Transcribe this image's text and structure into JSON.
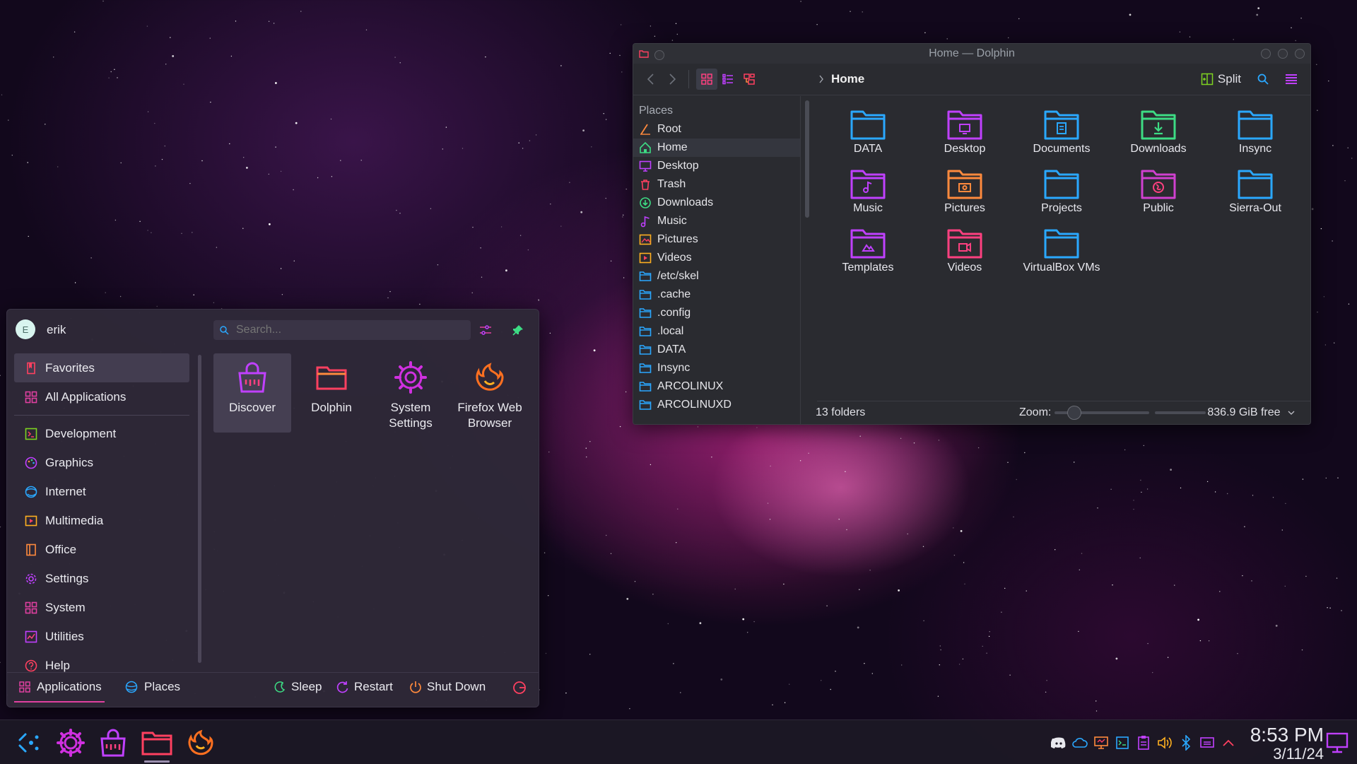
{
  "dolphin": {
    "title": "Home — Dolphin",
    "breadcrumb": "Home",
    "split_label": "Split",
    "places_header": "Places",
    "places": [
      {
        "label": "Root",
        "icon": "root-icon",
        "color": "#ff8a3d"
      },
      {
        "label": "Home",
        "icon": "home-icon",
        "color": "#3ddc84"
      },
      {
        "label": "Desktop",
        "icon": "desktop-icon",
        "color": "#c040ff"
      },
      {
        "label": "Trash",
        "icon": "trash-icon",
        "color": "#ff4060"
      },
      {
        "label": "Downloads",
        "icon": "downloads-icon",
        "color": "#3ddc84"
      },
      {
        "label": "Music",
        "icon": "music-icon",
        "color": "#c040ff"
      },
      {
        "label": "Pictures",
        "icon": "pictures-icon",
        "color": "#ffb020"
      },
      {
        "label": "Videos",
        "icon": "videos-icon",
        "color": "#ffb020"
      },
      {
        "label": "/etc/skel",
        "icon": "folder-icon",
        "color": "#2aa8ff"
      },
      {
        "label": ".cache",
        "icon": "folder-icon",
        "color": "#2aa8ff"
      },
      {
        "label": ".config",
        "icon": "folder-icon",
        "color": "#2aa8ff"
      },
      {
        "label": ".local",
        "icon": "folder-icon",
        "color": "#2aa8ff"
      },
      {
        "label": "DATA",
        "icon": "folder-icon",
        "color": "#2aa8ff"
      },
      {
        "label": "Insync",
        "icon": "folder-icon",
        "color": "#2aa8ff"
      },
      {
        "label": "ARCOLINUX",
        "icon": "folder-icon",
        "color": "#2aa8ff"
      },
      {
        "label": "ARCOLINUXD",
        "icon": "folder-icon",
        "color": "#2aa8ff"
      }
    ],
    "folders": [
      {
        "label": "DATA",
        "icon": "folder-icon",
        "color": "#2aa8ff"
      },
      {
        "label": "Desktop",
        "icon": "folder-desktop-icon",
        "color": "#c040ff"
      },
      {
        "label": "Documents",
        "icon": "folder-documents-icon",
        "color": "#2aa8ff"
      },
      {
        "label": "Downloads",
        "icon": "folder-downloads-icon",
        "color": "#3ddc84"
      },
      {
        "label": "Insync",
        "icon": "folder-icon",
        "color": "#2aa8ff"
      },
      {
        "label": "Music",
        "icon": "folder-music-icon",
        "color": "#c040ff"
      },
      {
        "label": "Pictures",
        "icon": "folder-pictures-icon",
        "color": "#ff8a3d"
      },
      {
        "label": "Projects",
        "icon": "folder-icon",
        "color": "#2aa8ff"
      },
      {
        "label": "Public",
        "icon": "folder-public-icon",
        "color": "#d040d0"
      },
      {
        "label": "Sierra-Out",
        "icon": "folder-icon",
        "color": "#2aa8ff"
      },
      {
        "label": "Templates",
        "icon": "folder-templates-icon",
        "color": "#c040ff"
      },
      {
        "label": "Videos",
        "icon": "folder-videos-icon",
        "color": "#ff4080"
      },
      {
        "label": "VirtualBox VMs",
        "icon": "folder-icon",
        "color": "#2aa8ff"
      }
    ],
    "status": {
      "count": "13 folders",
      "zoom_label": "Zoom:",
      "free": "836.9 GiB free"
    }
  },
  "launcher": {
    "avatar_letter": "E",
    "username": "erik",
    "search_placeholder": "Search...",
    "categories": [
      {
        "label": "Favorites",
        "icon": "favorites-icon",
        "color": "#ff4060"
      },
      {
        "label": "All Applications",
        "icon": "grid-icon",
        "color": "#e040a0"
      },
      {
        "label": "Development",
        "icon": "development-icon",
        "color": "#7ed321"
      },
      {
        "label": "Graphics",
        "icon": "graphics-icon",
        "color": "#c040ff"
      },
      {
        "label": "Internet",
        "icon": "internet-icon",
        "color": "#2aa8ff"
      },
      {
        "label": "Multimedia",
        "icon": "multimedia-icon",
        "color": "#ffb020"
      },
      {
        "label": "Office",
        "icon": "office-icon",
        "color": "#ff8a3d"
      },
      {
        "label": "Settings",
        "icon": "settings-icon",
        "color": "#c040ff"
      },
      {
        "label": "System",
        "icon": "system-icon",
        "color": "#e040a0"
      },
      {
        "label": "Utilities",
        "icon": "utilities-icon",
        "color": "#c040ff"
      },
      {
        "label": "Help",
        "icon": "help-icon",
        "color": "#ff4060"
      }
    ],
    "apps": [
      {
        "label": "Discover",
        "icon": "discover-icon",
        "color": "#c040ff"
      },
      {
        "label": "Dolphin",
        "icon": "dolphin-icon",
        "color": "#ff4060"
      },
      {
        "label": "System Settings",
        "icon": "system-settings-icon",
        "color": "#d030e0"
      },
      {
        "label": "Firefox Web Browser",
        "icon": "firefox-icon",
        "color": "#ff7020"
      }
    ],
    "footer": {
      "applications": "Applications",
      "places": "Places",
      "sleep": "Sleep",
      "restart": "Restart",
      "shutdown": "Shut Down"
    }
  },
  "panel": {
    "time": "8:53 PM",
    "date": "3/11/24",
    "launchers": [
      "app-launcher-icon",
      "system-settings-icon",
      "discover-icon",
      "dolphin-icon",
      "firefox-icon"
    ],
    "tray": [
      "discord-icon",
      "cloud-icon",
      "display-icon",
      "terminal-icon",
      "clipboard-icon",
      "volume-icon",
      "bluetooth-icon",
      "network-icon",
      "expand-icon"
    ]
  },
  "colors": {
    "accent": "#e040a0",
    "blue": "#2aa8ff",
    "green": "#3ddc84",
    "purple": "#c040ff",
    "orange": "#ff8a3d"
  }
}
